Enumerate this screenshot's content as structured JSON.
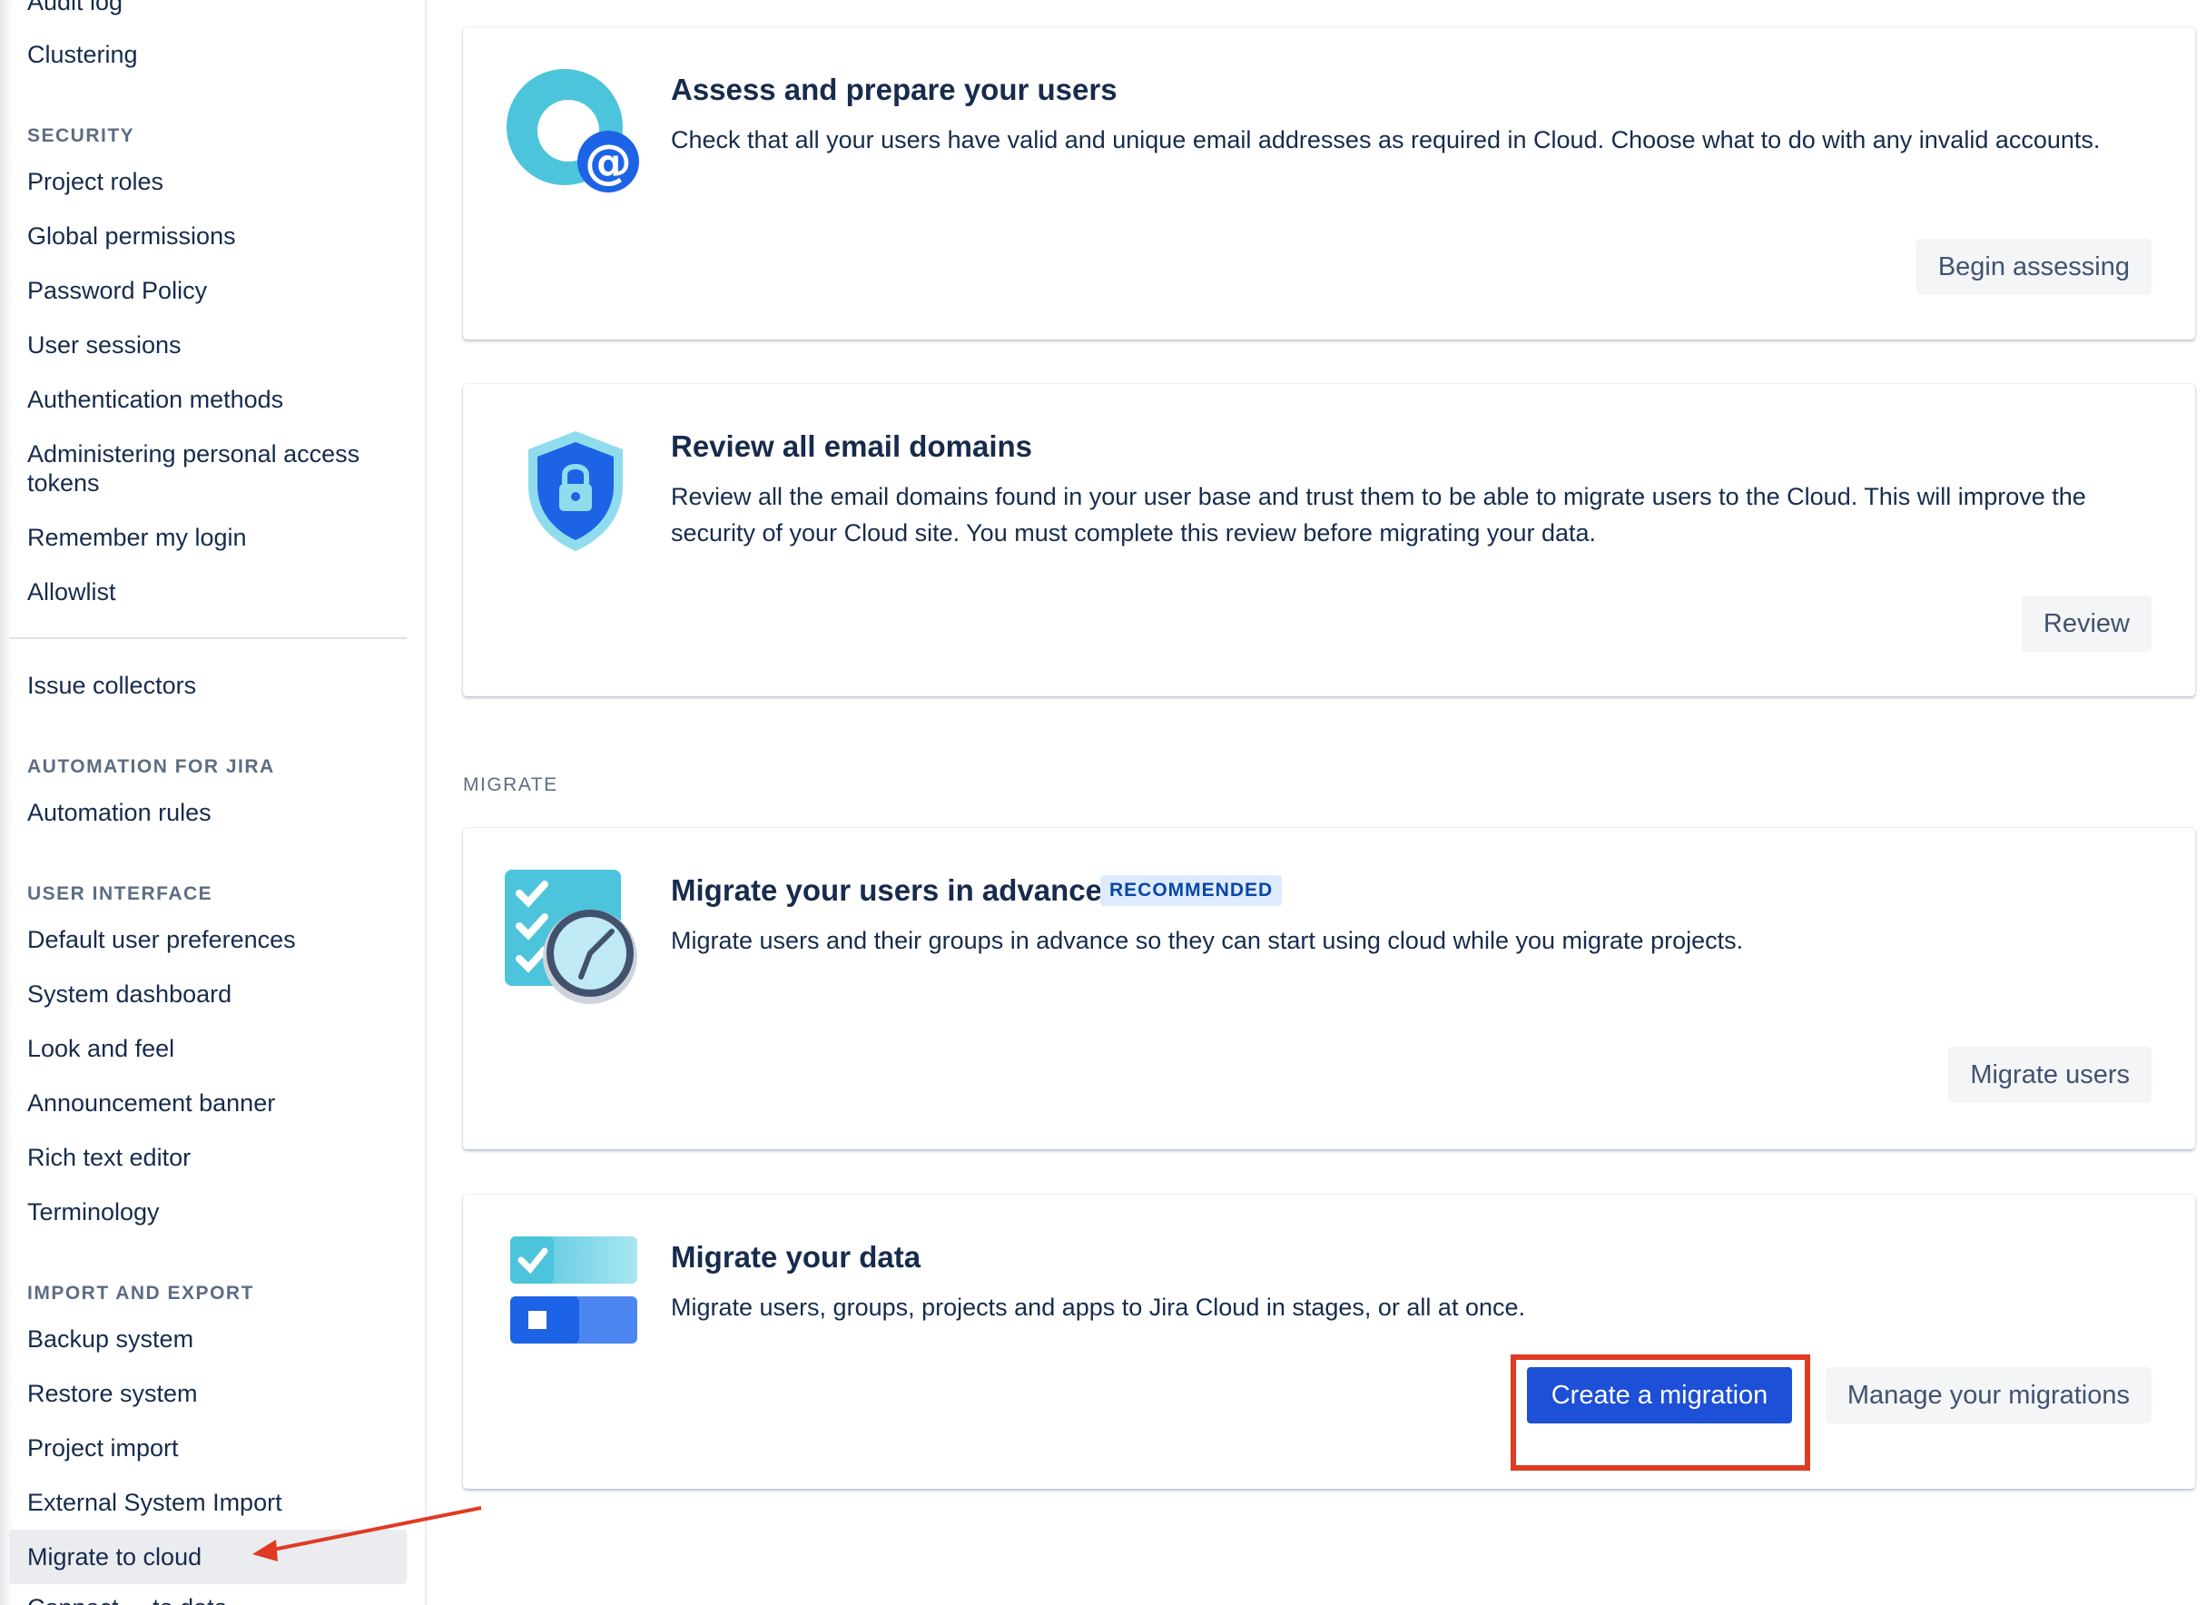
{
  "sidebar": {
    "items_top": [
      {
        "label": "Audit log"
      },
      {
        "label": "Clustering"
      }
    ],
    "security_heading": "SECURITY",
    "security_items": [
      {
        "label": "Project roles"
      },
      {
        "label": "Global permissions"
      },
      {
        "label": "Password Policy"
      },
      {
        "label": "User sessions"
      },
      {
        "label": "Authentication methods"
      },
      {
        "label": "Administering personal access tokens"
      },
      {
        "label": "Remember my login"
      },
      {
        "label": "Allowlist"
      }
    ],
    "issue_collectors": "Issue collectors",
    "automation_heading": "AUTOMATION FOR JIRA",
    "automation_items": [
      {
        "label": "Automation rules"
      }
    ],
    "ui_heading": "USER INTERFACE",
    "ui_items": [
      {
        "label": "Default user preferences"
      },
      {
        "label": "System dashboard"
      },
      {
        "label": "Look and feel"
      },
      {
        "label": "Announcement banner"
      },
      {
        "label": "Rich text editor"
      },
      {
        "label": "Terminology"
      }
    ],
    "import_heading": "IMPORT AND EXPORT",
    "import_items": [
      {
        "label": "Backup system"
      },
      {
        "label": "Restore system"
      },
      {
        "label": "Project import"
      },
      {
        "label": "External System Import"
      },
      {
        "label": "Migrate to cloud"
      },
      {
        "label": "Connect ... to data"
      }
    ],
    "active_item": "Migrate to cloud"
  },
  "main": {
    "cards": [
      {
        "title": "Assess and prepare your users",
        "description": "Check that all your users have valid and unique email addresses as required in Cloud. Choose what to do with any invalid accounts.",
        "button": "Begin assessing",
        "icon": "user-email-icon"
      },
      {
        "title": "Review all email domains",
        "description": "Review all the email domains found in your user base and trust them to be able to migrate users to the Cloud. This will improve the security of your Cloud site. You must complete this review before migrating your data.",
        "button": "Review",
        "icon": "shield-lock-icon"
      },
      {
        "title": "Migrate your users in advance",
        "badge": "RECOMMENDED",
        "description": "Migrate users and their groups in advance so they can start using cloud while you migrate projects.",
        "button": "Migrate users",
        "icon": "checklist-clock-icon"
      },
      {
        "title": "Migrate your data",
        "description": "Migrate users, groups, projects and apps to Jira Cloud in stages, or all at once.",
        "primary_button": "Create a migration",
        "secondary_button": "Manage your migrations",
        "icon": "data-toggle-icon"
      }
    ],
    "section_label": "MIGRATE"
  },
  "colors": {
    "primary": "#1d4fd7",
    "highlight": "#e03a23",
    "text": "#172b4d",
    "muted": "#5e6c84"
  }
}
